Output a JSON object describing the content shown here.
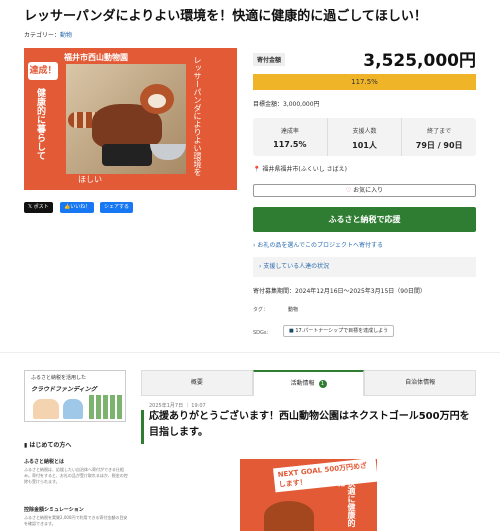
{
  "page": {
    "title": "レッサーパンダによりよい環境を！快適に健康的に過ごしてほしい！",
    "category_label": "カテゴリー：",
    "category_link": "動物"
  },
  "hero": {
    "badge": "達成！",
    "zoo_name": "福井市西山動物園",
    "vtext_left": "健康的に暮らして",
    "vtext_right": "レッサーパンダによりよい環境を",
    "bottom_text": "ほしい"
  },
  "share": {
    "post_label": "ポスト",
    "like_label": "いいね！",
    "share_label": "シェアする"
  },
  "stats": {
    "donation_label": "寄付金額",
    "donation_amount": "3,525,000円",
    "progress_percent": 117.5,
    "progress_text": "117.5%",
    "goal": "目標金額：3,000,000円",
    "items": [
      {
        "label": "達成率",
        "value": "117.5%"
      },
      {
        "label": "支援人数",
        "value": "101人"
      },
      {
        "label": "終了まで",
        "value": "79日 / 90日"
      }
    ],
    "location": "福井県福井市(ふくいし さばえ)",
    "favorite_label": "お気に入り",
    "donate_label": "ふるさと納税で応援",
    "link_message": "お礼の品を選んでこのプロジェクトへ寄付する",
    "supporter_link": "支援している人達の状況",
    "period": "寄付募集期間：2024年12月16日～2025年3月15日（90日間）",
    "tag_label": "タグ：",
    "tag_value": "動物",
    "sdgs_label": "SDGs：",
    "sdgs_button": "17.パートナーシップで目標を達成しよう"
  },
  "sidebar": {
    "banner_small": "ふるさと納税を活用した",
    "banner_big": "クラウドファンディング",
    "heading": "はじめての方へ",
    "items": [
      {
        "title": "ふるさと納税とは",
        "body": "ふるさと納税は、応援したい自治体へ寄付ができる仕組み。寄付をすると、お礼の品が受け取れるほか、税金の控除も受けられます。"
      },
      {
        "title": "控除金額シミュレーション",
        "body": "ふるさと納税を実質2,000円で利用できる寄付金額の目安を確認できます。"
      }
    ]
  },
  "tabs": [
    {
      "label": "概要"
    },
    {
      "label": "活動情報",
      "badge": "1"
    },
    {
      "label": "自治体情報"
    }
  ],
  "post": {
    "date": "2025年1月7日 ｜ 19:07",
    "title": "応援ありがとうございます！西山動物公園はネクストゴール500万円を目指します。",
    "image_badge": "NEXT GOAL 500万円めざします！",
    "image_vtext": "快適に健康的に"
  }
}
